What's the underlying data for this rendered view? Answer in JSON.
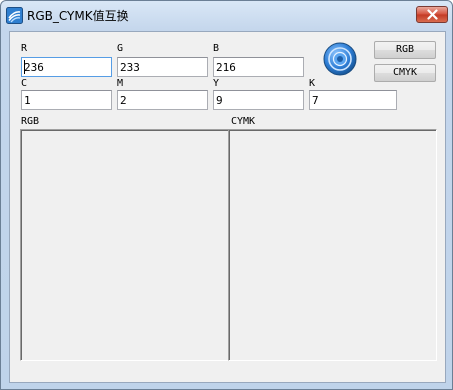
{
  "window": {
    "title": "RGB_CYMK值互换"
  },
  "rgb": {
    "r_label": "R",
    "g_label": "G",
    "b_label": "B",
    "r_value": "236",
    "g_value": "233",
    "b_value": "216"
  },
  "cymk": {
    "c_label": "C",
    "m_label": "M",
    "y_label": "Y",
    "k_label": "K",
    "c_value": "1",
    "m_value": "2",
    "y_value": "9",
    "k_value": "7"
  },
  "buttons": {
    "rgb_label": "RGB",
    "cymk_label": "CMYK"
  },
  "panels": {
    "rgb_label": "RGB",
    "cymk_label": "CYMK"
  },
  "icons": {
    "app": "app-logo-icon",
    "close": "close-icon",
    "knob": "color-wheel-icon"
  }
}
